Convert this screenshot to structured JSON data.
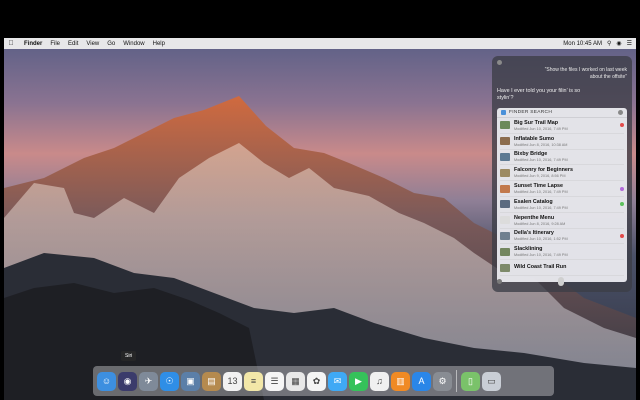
{
  "menubar": {
    "app": "Finder",
    "items": [
      "File",
      "Edit",
      "View",
      "Go",
      "Window",
      "Help"
    ],
    "clock": "Mon 10:45 AM"
  },
  "siri": {
    "user_query": "“Show the files I worked on last week about the offsite”",
    "reply": "Have I ever told you your filin’ is so stylin’?",
    "card_title": "FINDER SEARCH",
    "results": [
      {
        "name": "Big Sur Trail Map",
        "modified": "Modified Jun 10, 2016, 7:49 PM",
        "tag_color": "#e24b4b",
        "thumb": "#6b8a5a"
      },
      {
        "name": "Inflatable Sumo",
        "modified": "Modified Jun 8, 2016, 10:38 AM",
        "tag_color": "",
        "thumb": "#8c6d4e"
      },
      {
        "name": "Bixby Bridge",
        "modified": "Modified Jun 10, 2016, 7:49 PM",
        "tag_color": "",
        "thumb": "#5d7a93"
      },
      {
        "name": "Falconry for Beginners",
        "modified": "Modified Jun 9, 2016, 8:56 PM",
        "tag_color": "",
        "thumb": "#9c8a62"
      },
      {
        "name": "Sunset Time Lapse",
        "modified": "Modified Jun 10, 2016, 7:49 PM",
        "tag_color": "#b36ad9",
        "thumb": "#c2794c"
      },
      {
        "name": "Esalen Catalog",
        "modified": "Modified Jun 10, 2016, 7:49 PM",
        "tag_color": "#5cc05c",
        "thumb": "#5b6a7f"
      },
      {
        "name": "Nepenthe Menu",
        "modified": "Modified Jun 8, 2016, 9:28 AM",
        "tag_color": "",
        "thumb": "#dcdcdc"
      },
      {
        "name": "Della's Itinerary",
        "modified": "Modified Jun 10, 2016, 1:52 PM",
        "tag_color": "#e24b4b",
        "thumb": "#6f7f8f"
      },
      {
        "name": "Slacklining",
        "modified": "Modified Jun 10, 2016, 7:49 PM",
        "tag_color": "",
        "thumb": "#73865f"
      },
      {
        "name": "Wild Coast Trail Run",
        "modified": "",
        "tag_color": "",
        "thumb": "#7d8a6a"
      }
    ]
  },
  "dock": {
    "tooltip": "Siri",
    "icons": [
      {
        "name": "finder-icon",
        "color": "#3d8fe0",
        "glyph": "☺"
      },
      {
        "name": "siri-icon",
        "color": "#3b3b6b",
        "glyph": "◉"
      },
      {
        "name": "launchpad-icon",
        "color": "#7f8a99",
        "glyph": "✈"
      },
      {
        "name": "safari-icon",
        "color": "#2f8ee6",
        "glyph": "☉"
      },
      {
        "name": "photo-browser-icon",
        "color": "#5b7fa8",
        "glyph": "▣"
      },
      {
        "name": "notes-contacts-icon",
        "color": "#b58a4e",
        "glyph": "▤"
      },
      {
        "name": "calendar-icon",
        "color": "#f2f2f2",
        "glyph": "13"
      },
      {
        "name": "notes-icon",
        "color": "#f2e7a8",
        "glyph": "≡"
      },
      {
        "name": "reminders-icon",
        "color": "#f5f5f5",
        "glyph": "☰"
      },
      {
        "name": "preview-icon",
        "color": "#e8e8e8",
        "glyph": "▦"
      },
      {
        "name": "photos-icon",
        "color": "#f4f4f4",
        "glyph": "✿"
      },
      {
        "name": "messages-icon",
        "color": "#3fa9f5",
        "glyph": "✉"
      },
      {
        "name": "facetime-icon",
        "color": "#35c25a",
        "glyph": "▶"
      },
      {
        "name": "itunes-icon",
        "color": "#f0f0f0",
        "glyph": "♫"
      },
      {
        "name": "ibooks-icon",
        "color": "#f08a24",
        "glyph": "▥"
      },
      {
        "name": "app-store-icon",
        "color": "#2a86e8",
        "glyph": "A"
      },
      {
        "name": "system-preferences-icon",
        "color": "#888c93",
        "glyph": "⚙"
      },
      {
        "name": "iphone-icon",
        "color": "#7ac26a",
        "glyph": "▯"
      },
      {
        "name": "trash-icon",
        "color": "#c9ced6",
        "glyph": "▭"
      }
    ]
  },
  "colors": {
    "menubar_bg": "#eeeeee",
    "siri_panel": "#3c3e46",
    "accent_blue": "#3d8fe0"
  }
}
